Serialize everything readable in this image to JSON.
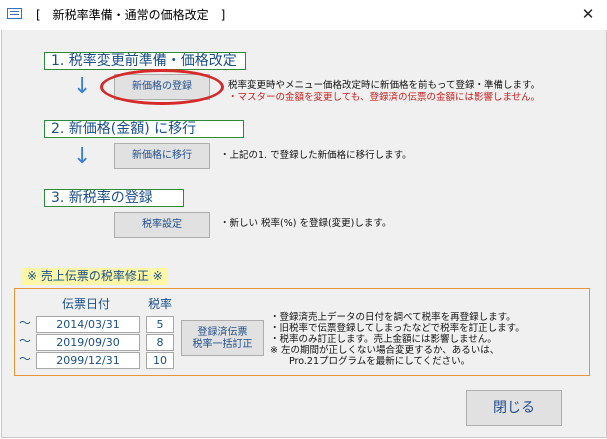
{
  "window": {
    "title": "[　新税率準備・通常の価格改定　]",
    "close_symbol": "✕"
  },
  "sections": [
    {
      "heading": "1. 税率変更前準備・価格改定",
      "button": "新価格の登録",
      "desc": [
        "税率変更時やメニュー価格改定時に新価格を前もって登録・準備します。",
        "・マスターの金額を変更しても、登録済の伝票の金額には影響しません。"
      ]
    },
    {
      "heading": "2. 新価格(金額) に移行",
      "button": "新価格に移行",
      "desc": [
        "・上記の1. で登録した新価格に移行します。"
      ]
    },
    {
      "heading": "3. 新税率の登録",
      "button": "税率設定",
      "desc": [
        "・新しい 税率(%) を登録(変更)します。"
      ]
    }
  ],
  "tax_fix": {
    "label": "※ 売上伝票の税率修正 ※",
    "col_date": "伝票日付",
    "col_rate": "税率",
    "tilde": "～",
    "rows": [
      {
        "date": "2014/03/31",
        "rate": "5"
      },
      {
        "date": "2019/09/30",
        "rate": "8"
      },
      {
        "date": "2099/12/31",
        "rate": "10"
      }
    ],
    "button_line1": "登録済伝票",
    "button_line2": "税率一括訂正",
    "desc": [
      "・登録済売上データの日付を調べて税率を再登録します。",
      "・旧税率で伝票登録してしまったなどで税率を訂正します。",
      "・税率のみ訂正します。売上金額には影響しません。",
      "※ 左の期間が正しくない場合変更するか、あるいは、",
      "　　Pro.21プログラムを最新にしてください。"
    ]
  },
  "footer": {
    "close_label": "閉じる"
  },
  "colors": {
    "heading_border": "#2e8b3a",
    "heading_text": "#1a4f8a",
    "highlight_oval": "#d62a2a",
    "warning_text": "#c81e1e",
    "orange_border": "#e8963a",
    "yellow_label": "#fbf7a6"
  },
  "icons": {
    "app": "form-window-icon",
    "arrow": "down-arrow-icon",
    "close": "close-icon"
  }
}
